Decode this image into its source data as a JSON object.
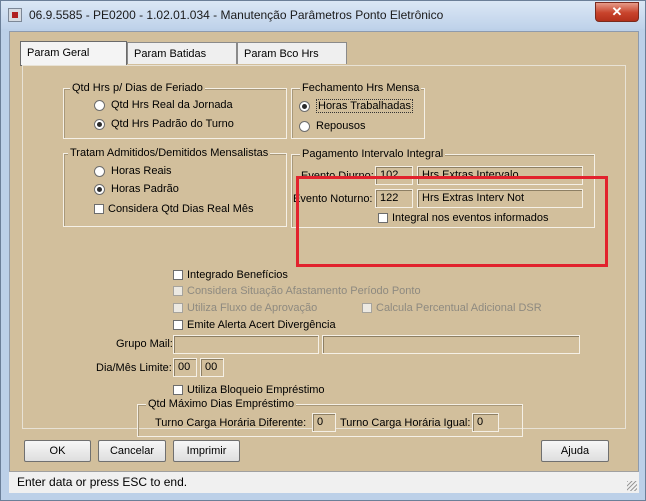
{
  "window": {
    "title": "06.9.5585 - PE0200 - 1.02.01.034 - Manutenção Parâmetros Ponto Eletrônico",
    "close_label": "✕"
  },
  "tabs": [
    "Param Geral",
    "Param Batidas",
    "Param Bco Hrs"
  ],
  "feriado": {
    "title": "Qtd Hrs p/ Dias de Feriado",
    "options": [
      "Qtd Hrs Real da Jornada",
      "Qtd Hrs Padrão do Turno"
    ],
    "selected": 1
  },
  "fechamento": {
    "title": "Fechamento Hrs Mensa",
    "options": [
      "Horas Trabalhadas",
      "Repousos"
    ],
    "selected": 0
  },
  "admitidos": {
    "title": "Tratam Admitidos/Demitidos Mensalistas",
    "options": [
      "Horas Reais",
      "Horas Padrão"
    ],
    "selected": 1,
    "checkbox": "Considera Qtd Dias Real Mês"
  },
  "intervalo": {
    "title": "Pagamento Intervalo Integral",
    "diurno_label": "Evento Diurno:",
    "diurno_code": "102",
    "diurno_desc": "Hrs Extras Intervalo",
    "noturno_label": "Evento Noturno:",
    "noturno_code": "122",
    "noturno_desc": "Hrs Extras Interv Not",
    "checkbox": "Integral nos eventos informados"
  },
  "checks": {
    "integrado": "Integrado Benefícios",
    "afastamento": "Considera Situação Afastamento Período Ponto",
    "fluxo": "Utiliza Fluxo de Aprovação",
    "percentual": "Calcula Percentual Adicional DSR",
    "alerta": "Emite Alerta Acert Divergência",
    "bloqueio": "Utiliza Bloqueio Empréstimo"
  },
  "grupo_mail": {
    "label": "Grupo Mail:",
    "value1": "",
    "value2": ""
  },
  "dia_mes": {
    "label": "Dia/Mês Limite:",
    "dia": "00",
    "mes": "00"
  },
  "emprestimo": {
    "title": "Qtd Máximo Dias Empréstimo",
    "turno_dif_label": "Turno Carga Horária Diferente:",
    "turno_dif_value": "0",
    "turno_igual_label": "Turno Carga Horária Igual:",
    "turno_igual_value": "0"
  },
  "buttons": {
    "ok": "OK",
    "cancelar": "Cancelar",
    "imprimir": "Imprimir",
    "ajuda": "Ajuda"
  },
  "status": "Enter data or press ESC to end.",
  "colors": {
    "panel_bg": "#d2bf9c",
    "highlight": "#e2222d"
  }
}
